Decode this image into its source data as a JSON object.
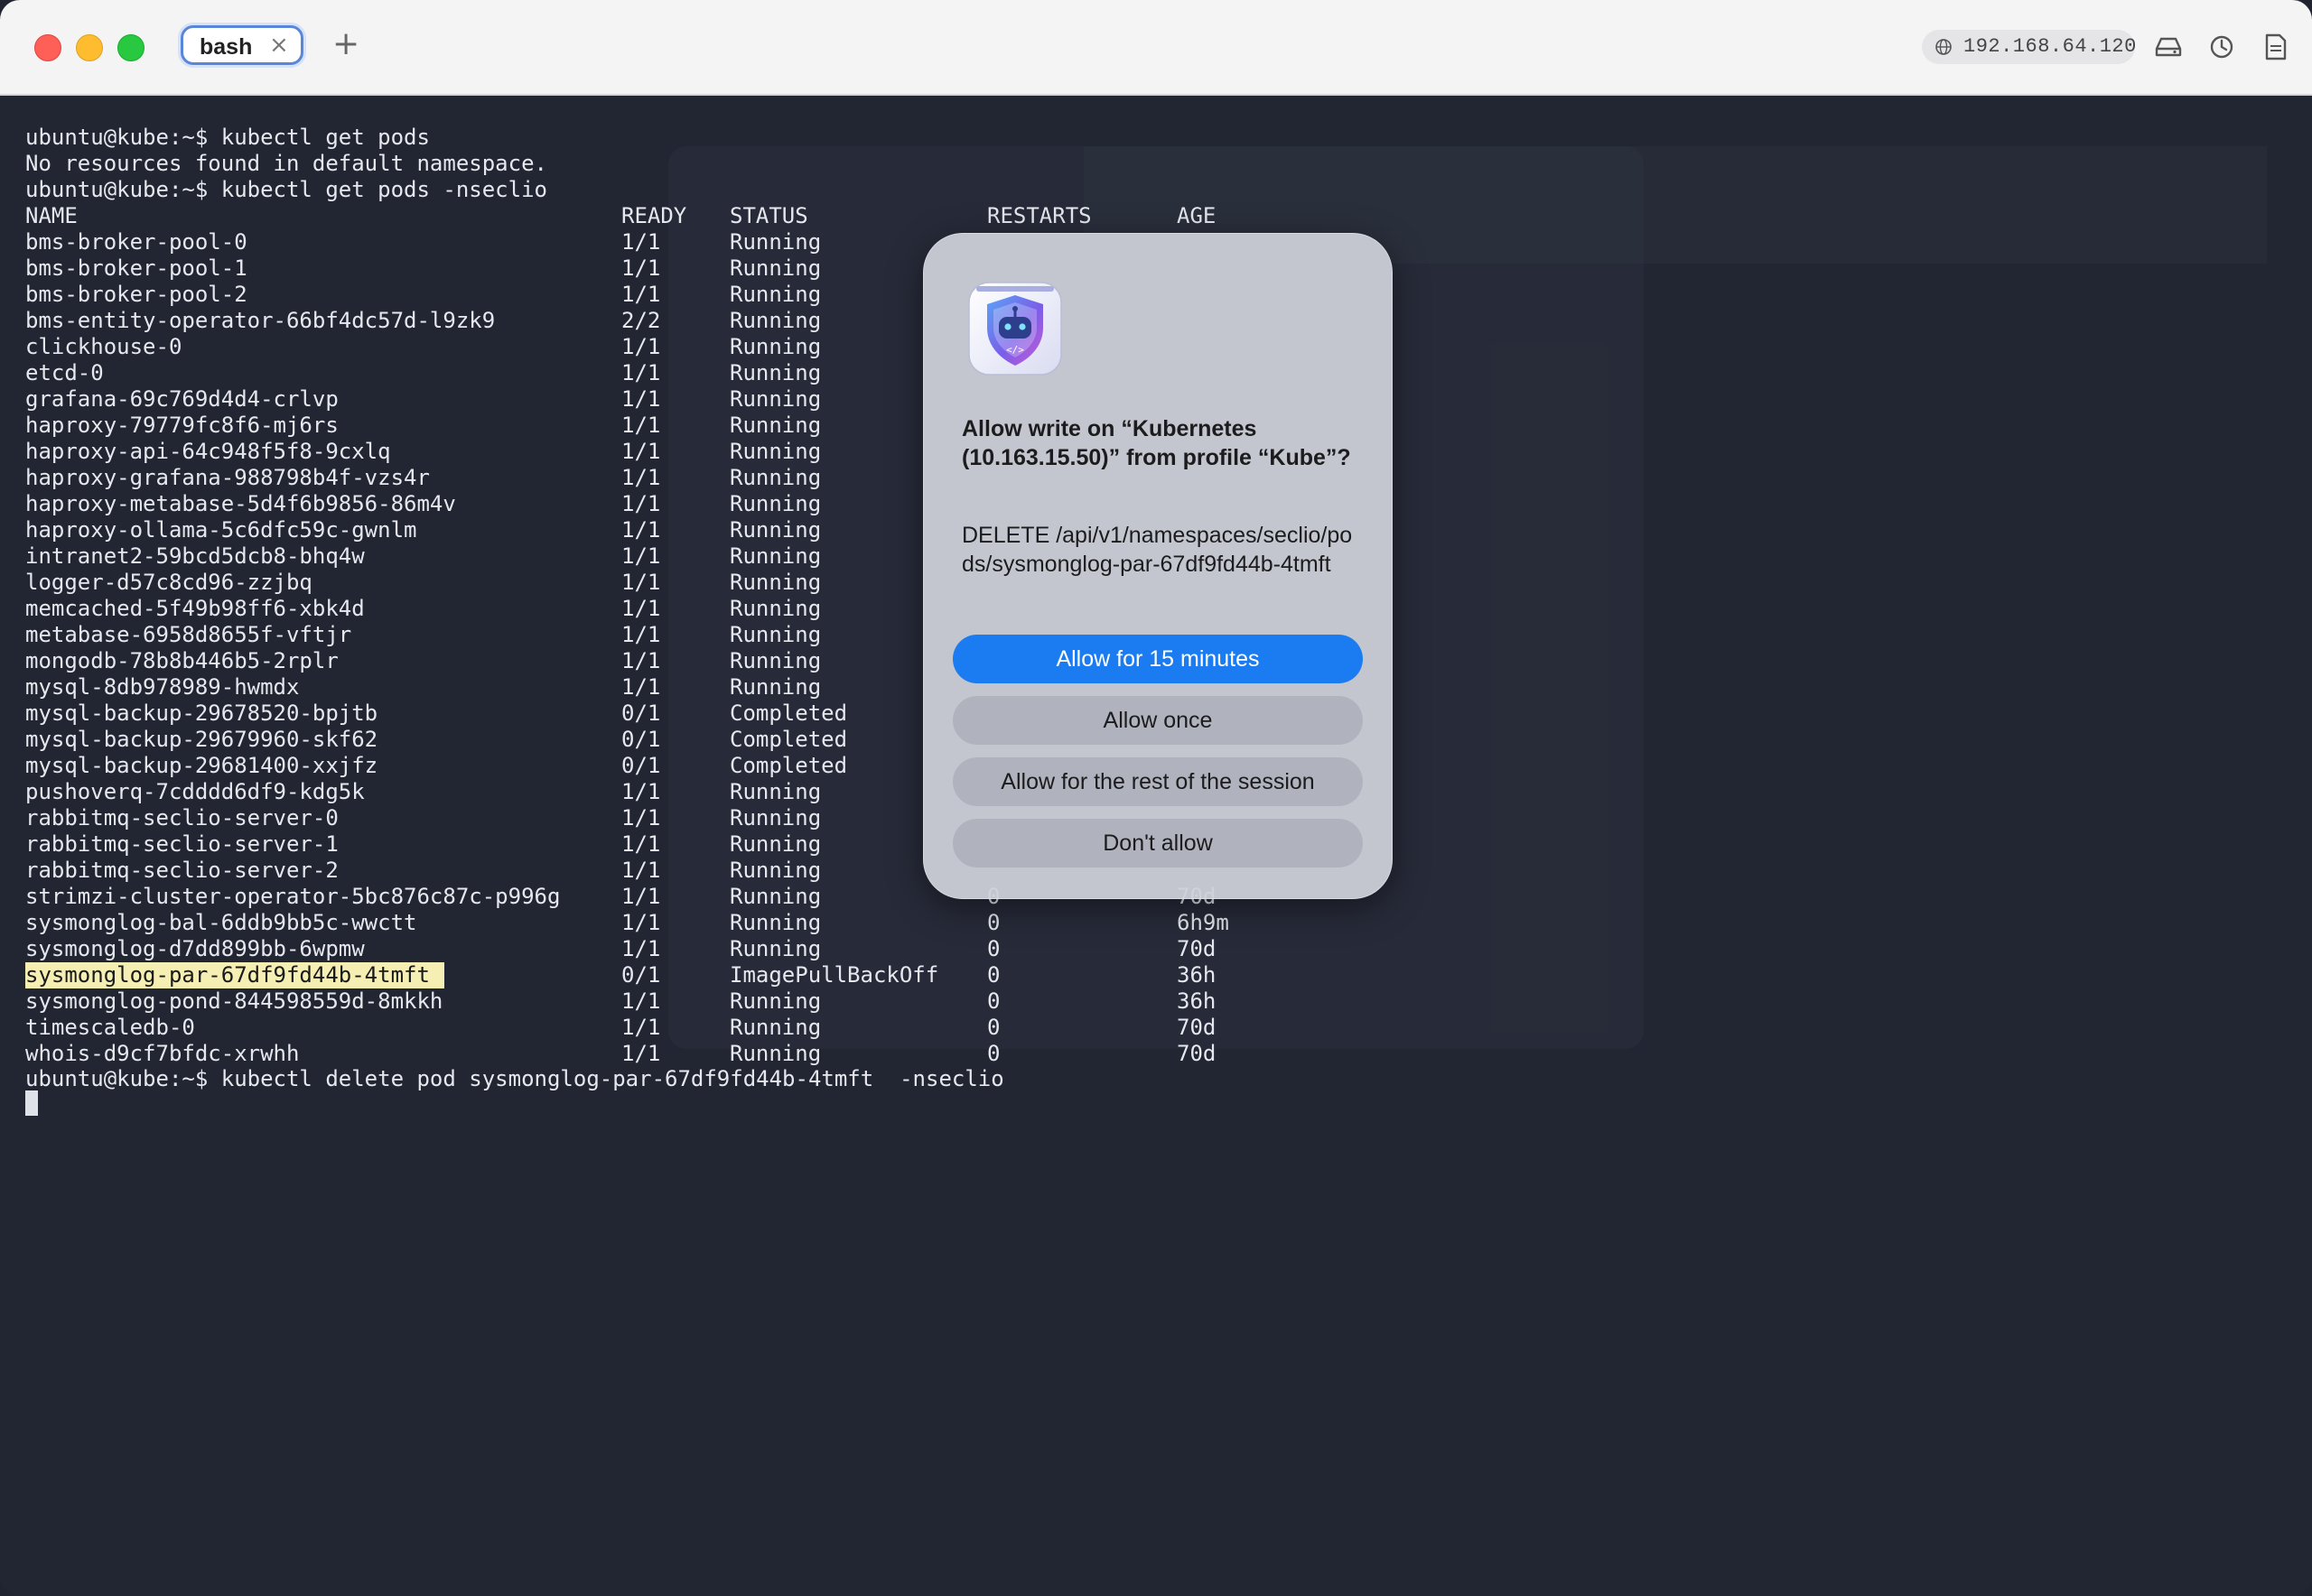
{
  "tab": {
    "label": "bash",
    "close": "×",
    "new_tab": "+"
  },
  "toolbar": {
    "host": "192.168.64.120",
    "icons": [
      "globe-icon",
      "drive-icon",
      "history-icon",
      "document-icon"
    ]
  },
  "terminal": {
    "prompt1": "ubuntu@kube:~$ kubectl get pods",
    "message": "No resources found in default namespace.",
    "prompt2": "ubuntu@kube:~$ kubectl get pods -nseclio",
    "headers": {
      "name": "NAME",
      "ready": "READY",
      "status": "STATUS",
      "restarts": "RESTARTS",
      "age": "AGE"
    },
    "pods": [
      {
        "name": "bms-broker-pool-0",
        "ready": "1/1",
        "status": "Running",
        "restarts": "",
        "age": ""
      },
      {
        "name": "bms-broker-pool-1",
        "ready": "1/1",
        "status": "Running",
        "restarts": "",
        "age": ""
      },
      {
        "name": "bms-broker-pool-2",
        "ready": "1/1",
        "status": "Running",
        "restarts": "",
        "age": ""
      },
      {
        "name": "bms-entity-operator-66bf4dc57d-l9zk9",
        "ready": "2/2",
        "status": "Running",
        "restarts": "",
        "age": ""
      },
      {
        "name": "clickhouse-0",
        "ready": "1/1",
        "status": "Running",
        "restarts": "",
        "age": ""
      },
      {
        "name": "etcd-0",
        "ready": "1/1",
        "status": "Running",
        "restarts": "",
        "age": ""
      },
      {
        "name": "grafana-69c769d4d4-crlvp",
        "ready": "1/1",
        "status": "Running",
        "restarts": "",
        "age": ""
      },
      {
        "name": "haproxy-79779fc8f6-mj6rs",
        "ready": "1/1",
        "status": "Running",
        "restarts": "",
        "age": ""
      },
      {
        "name": "haproxy-api-64c948f5f8-9cxlq",
        "ready": "1/1",
        "status": "Running",
        "restarts": "",
        "age": ""
      },
      {
        "name": "haproxy-grafana-988798b4f-vzs4r",
        "ready": "1/1",
        "status": "Running",
        "restarts": "",
        "age": ""
      },
      {
        "name": "haproxy-metabase-5d4f6b9856-86m4v",
        "ready": "1/1",
        "status": "Running",
        "restarts": "",
        "age": ""
      },
      {
        "name": "haproxy-ollama-5c6dfc59c-gwnlm",
        "ready": "1/1",
        "status": "Running",
        "restarts": "",
        "age": ""
      },
      {
        "name": "intranet2-59bcd5dcb8-bhq4w",
        "ready": "1/1",
        "status": "Running",
        "restarts": "",
        "age": ""
      },
      {
        "name": "logger-d57c8cd96-zzjbq",
        "ready": "1/1",
        "status": "Running",
        "restarts": "",
        "age": ""
      },
      {
        "name": "memcached-5f49b98ff6-xbk4d",
        "ready": "1/1",
        "status": "Running",
        "restarts": "",
        "age": ""
      },
      {
        "name": "metabase-6958d8655f-vftjr",
        "ready": "1/1",
        "status": "Running",
        "restarts": "",
        "age": ""
      },
      {
        "name": "mongodb-78b8b446b5-2rplr",
        "ready": "1/1",
        "status": "Running",
        "restarts": "",
        "age": ""
      },
      {
        "name": "mysql-8db978989-hwmdx",
        "ready": "1/1",
        "status": "Running",
        "restarts": "",
        "age": ""
      },
      {
        "name": "mysql-backup-29678520-bpjtb",
        "ready": "0/1",
        "status": "Completed",
        "restarts": "",
        "age": ""
      },
      {
        "name": "mysql-backup-29679960-skf62",
        "ready": "0/1",
        "status": "Completed",
        "restarts": "",
        "age": ""
      },
      {
        "name": "mysql-backup-29681400-xxjfz",
        "ready": "0/1",
        "status": "Completed",
        "restarts": "",
        "age": ""
      },
      {
        "name": "pushoverq-7cdddd6df9-kdg5k",
        "ready": "1/1",
        "status": "Running",
        "restarts": "",
        "age": ""
      },
      {
        "name": "rabbitmq-seclio-server-0",
        "ready": "1/1",
        "status": "Running",
        "restarts": "",
        "age": ""
      },
      {
        "name": "rabbitmq-seclio-server-1",
        "ready": "1/1",
        "status": "Running",
        "restarts": "",
        "age": ""
      },
      {
        "name": "rabbitmq-seclio-server-2",
        "ready": "1/1",
        "status": "Running",
        "restarts": "",
        "age": ""
      },
      {
        "name": "strimzi-cluster-operator-5bc876c87c-p996g",
        "ready": "1/1",
        "status": "Running",
        "restarts": "0",
        "age": "70d"
      },
      {
        "name": "sysmonglog-bal-6ddb9bb5c-wwctt",
        "ready": "1/1",
        "status": "Running",
        "restarts": "0",
        "age": "6h9m"
      },
      {
        "name": "sysmonglog-d7dd899bb-6wpmw",
        "ready": "1/1",
        "status": "Running",
        "restarts": "0",
        "age": "70d"
      },
      {
        "name": "sysmonglog-par-67df9fd44b-4tmft",
        "ready": "0/1",
        "status": "ImagePullBackOff",
        "restarts": "0",
        "age": "36h",
        "highlighted": true
      },
      {
        "name": "sysmonglog-pond-844598559d-8mkkh",
        "ready": "1/1",
        "status": "Running",
        "restarts": "0",
        "age": "36h"
      },
      {
        "name": "timescaledb-0",
        "ready": "1/1",
        "status": "Running",
        "restarts": "0",
        "age": "70d"
      },
      {
        "name": "whois-d9cf7bfdc-xrwhh",
        "ready": "1/1",
        "status": "Running",
        "restarts": "0",
        "age": "70d"
      }
    ],
    "prompt3": "ubuntu@kube:~$ kubectl delete pod sysmonglog-par-67df9fd44b-4tmft  -nseclio"
  },
  "dialog": {
    "icon": "robot-shield-icon",
    "title": "Allow write on “Kubernetes (10.163.15.50)” from profile “Kube”?",
    "body": "DELETE /api/v1/namespaces/seclio/pods/sysmonglog-par-67df9fd44b-4tmft",
    "buttons": {
      "allow_15": "Allow for 15 minutes",
      "allow_once": "Allow once",
      "allow_session": "Allow for the rest of the session",
      "deny": "Don't allow"
    }
  },
  "colors": {
    "terminal_bg": "#222633",
    "text": "#e6e8ee",
    "highlight": "#f6efb4",
    "primary_button": "#1a7cf0"
  }
}
